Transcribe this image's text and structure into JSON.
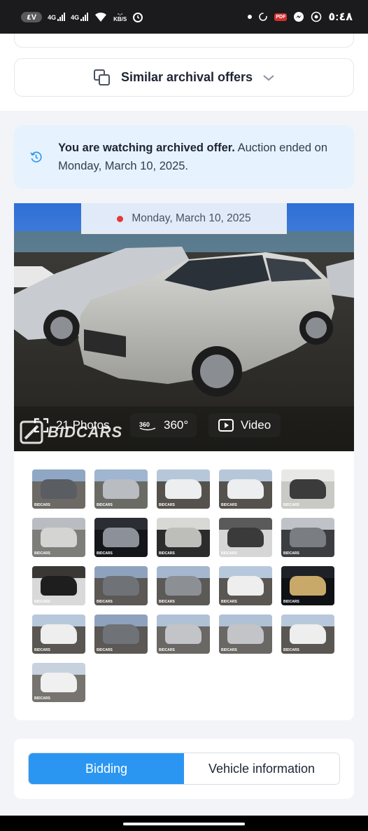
{
  "status_bar": {
    "left_badge": "٤V",
    "net1": "4G",
    "net2": "4G",
    "speed_value": "-.-",
    "speed_unit": "KB/S",
    "pdf_label": "PDF",
    "time": "٥:٤٨"
  },
  "similar_offers": {
    "label": "Similar archival offers"
  },
  "archived_notice": {
    "bold_text": "You are watching archived offer.",
    "rest_text": " Auction ended on Monday, March 10, 2025."
  },
  "gallery": {
    "date": "Monday, March 10, 2025",
    "photos_label": "21 Photos",
    "rotate_label": "360°",
    "video_label": "Video",
    "watermark": "BIDCARS",
    "thumbnails": [
      {
        "kind": "grey-suv-lot"
      },
      {
        "kind": "silver-car-lot"
      },
      {
        "kind": "white-suv-lot"
      },
      {
        "kind": "white-suv-lot"
      },
      {
        "kind": "interior-white"
      },
      {
        "kind": "damaged-front"
      },
      {
        "kind": "dashboard"
      },
      {
        "kind": "interior-seats"
      },
      {
        "kind": "window-sticker"
      },
      {
        "kind": "engine-bay"
      },
      {
        "kind": "key-fob"
      },
      {
        "kind": "grey-suv-front"
      },
      {
        "kind": "grey-suv-side"
      },
      {
        "kind": "white-suv-rear"
      },
      {
        "kind": "gauge-cluster"
      },
      {
        "kind": "white-suv-rear"
      },
      {
        "kind": "grey-suv-front"
      },
      {
        "kind": "silver-car-side"
      },
      {
        "kind": "silver-car-side"
      },
      {
        "kind": "white-suv-rear"
      },
      {
        "kind": "white-car-side"
      }
    ]
  },
  "tabs": {
    "active": "Bidding",
    "inactive": "Vehicle information"
  },
  "colors": {
    "accent": "#2b96f2",
    "notice_bg": "#e6f2fd",
    "status_dot": "#e53935"
  }
}
